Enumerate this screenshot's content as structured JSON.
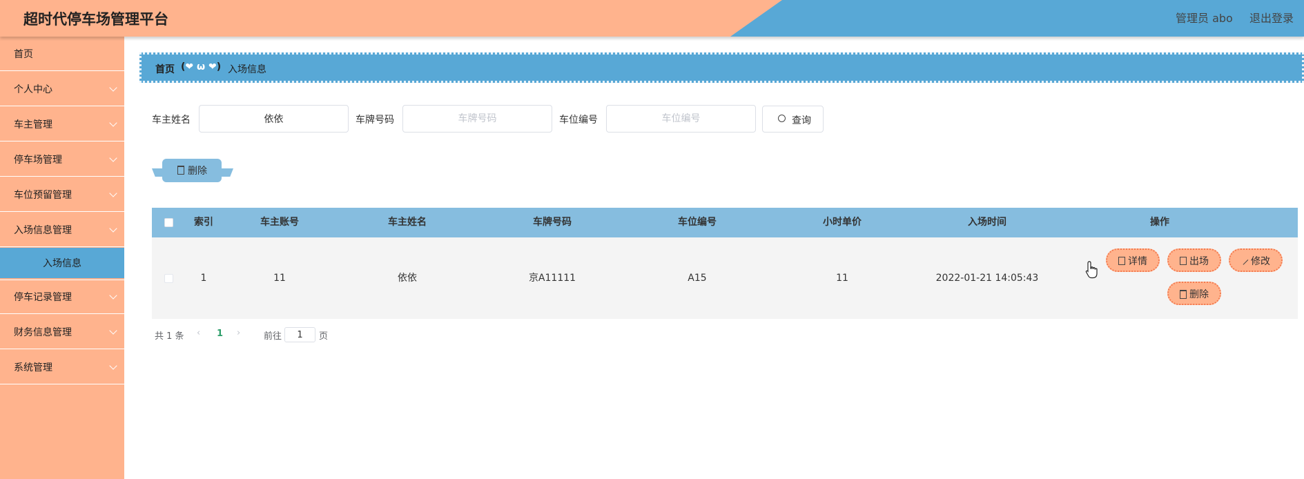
{
  "header": {
    "title": "超时代停车场管理平台",
    "admin_text": "管理员 abo",
    "logout": "退出登录",
    "colors": {
      "orange": "#ffb38d",
      "blue": "#58a8d6"
    }
  },
  "sidebar": {
    "items": [
      {
        "label": "首页",
        "has_arrow": false
      },
      {
        "label": "个人中心",
        "has_arrow": true
      },
      {
        "label": "车主管理",
        "has_arrow": true
      },
      {
        "label": "停车场管理",
        "has_arrow": true
      },
      {
        "label": "车位预留管理",
        "has_arrow": true
      },
      {
        "label": "入场信息管理",
        "has_arrow": true
      },
      {
        "label": "停车记录管理",
        "has_arrow": true
      },
      {
        "label": "财务信息管理",
        "has_arrow": true
      },
      {
        "label": "系统管理",
        "has_arrow": true
      }
    ],
    "active_submenu": "入场信息"
  },
  "breadcrumb": {
    "home": "首页",
    "separator": "(",
    "separator_mid": "❤ ω ❤",
    "separator_end": ")",
    "current": "入场信息"
  },
  "search": {
    "owner_name_label": "车主姓名",
    "owner_name_value": "依依",
    "plate_label": "车牌号码",
    "plate_placeholder": "车牌号码",
    "space_label": "车位编号",
    "space_placeholder": "车位编号",
    "query_button": "查询"
  },
  "actions": {
    "delete_button": "删除"
  },
  "table": {
    "columns": [
      "索引",
      "车主账号",
      "车主姓名",
      "车牌号码",
      "车位编号",
      "小时单价",
      "入场时间",
      "操作"
    ],
    "rows": [
      {
        "index": "1",
        "account": "11",
        "name": "依依",
        "plate": "京A11111",
        "space": "A15",
        "price": "11",
        "entry_time": "2022-01-21 14:05:43"
      }
    ],
    "row_actions": {
      "detail": "详情",
      "exit": "出场",
      "edit": "修改",
      "delete": "删除"
    }
  },
  "pagination": {
    "total": "共 1 条",
    "current_page": "1",
    "goto_label": "前往",
    "goto_value": "1",
    "page_suffix": "页"
  }
}
